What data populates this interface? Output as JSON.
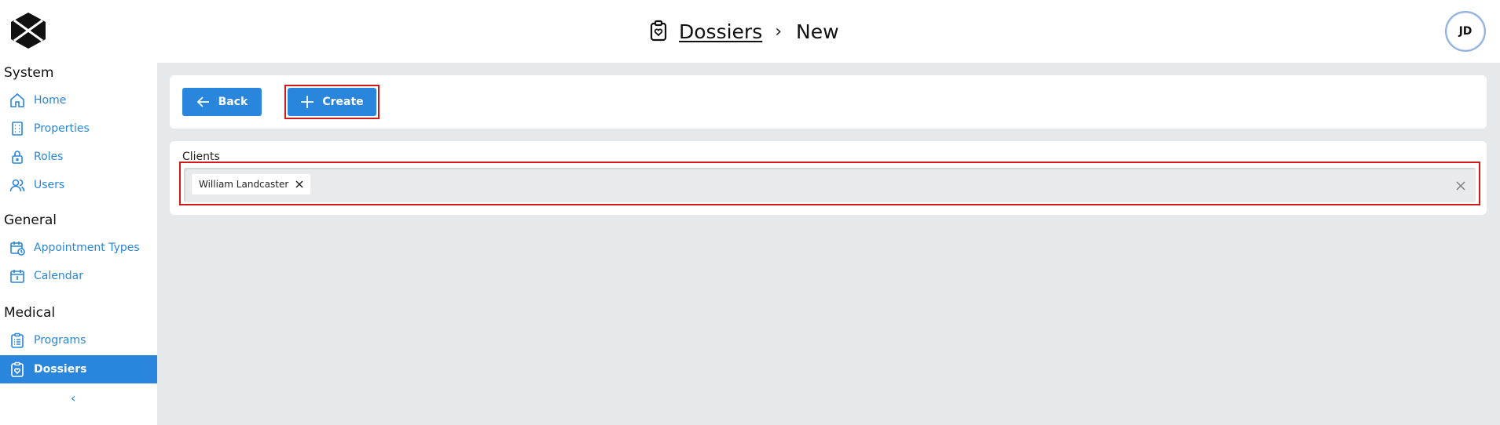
{
  "header": {
    "breadcrumb": {
      "parent_label": "Dossiers",
      "separator": "›",
      "current_label": "New"
    },
    "user_initials": "JD"
  },
  "sidebar": {
    "sections": [
      {
        "title": "System",
        "items": [
          {
            "label": "Home",
            "icon": "home-icon"
          },
          {
            "label": "Properties",
            "icon": "building-icon"
          },
          {
            "label": "Roles",
            "icon": "lock-icon"
          },
          {
            "label": "Users",
            "icon": "users-icon"
          }
        ]
      },
      {
        "title": "General",
        "items": [
          {
            "label": "Appointment Types",
            "icon": "calendar-clock-icon"
          },
          {
            "label": "Calendar",
            "icon": "calendar-icon"
          }
        ]
      },
      {
        "title": "Medical",
        "items": [
          {
            "label": "Programs",
            "icon": "clipboard-list-icon"
          },
          {
            "label": "Dossiers",
            "icon": "clipboard-heart-icon",
            "active": true
          }
        ]
      }
    ],
    "collapse_glyph": "‹"
  },
  "toolbar": {
    "back_label": "Back",
    "create_label": "Create"
  },
  "form": {
    "clients_label": "Clients",
    "selected_clients": [
      "William Landcaster"
    ]
  },
  "colors": {
    "accent": "#2a86dc",
    "highlight": "#d21a1a",
    "content_bg": "#e6e9ec"
  }
}
